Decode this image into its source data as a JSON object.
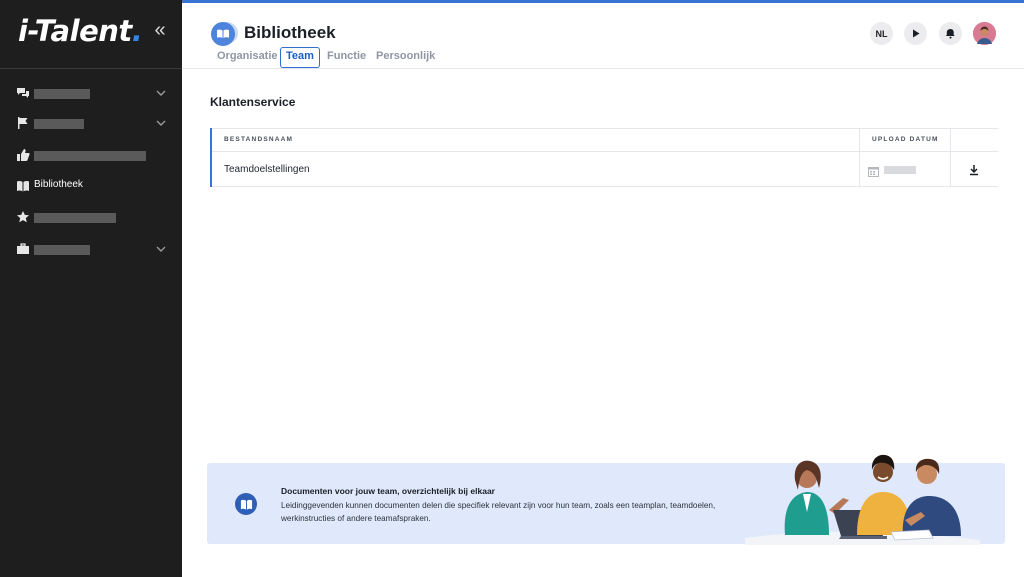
{
  "app": {
    "logo_main": "i-Talent",
    "logo_dot": "."
  },
  "colors": {
    "accent": "#3a73d6",
    "sidebar_bg": "#1e1e1e",
    "banner_bg": "#dfe9fb",
    "tab_active": "#1b5fc2"
  },
  "sidebar": {
    "collapse_icon": "double-chevron-left-icon",
    "items": [
      {
        "icon": "chat-icon",
        "label": "",
        "has_chevron": true
      },
      {
        "icon": "flag-icon",
        "label": "",
        "has_chevron": true
      },
      {
        "icon": "thumbs-up-icon",
        "label": "",
        "has_chevron": false
      },
      {
        "icon": "book-icon",
        "label": "Bibliotheek",
        "has_chevron": false
      },
      {
        "icon": "star-icon",
        "label": "",
        "has_chevron": false
      },
      {
        "icon": "briefcase-icon",
        "label": "",
        "has_chevron": true
      }
    ]
  },
  "header": {
    "title": "Bibliotheek",
    "tabs": [
      {
        "label": "Organisatie",
        "active": false
      },
      {
        "label": "Team",
        "active": true
      },
      {
        "label": "Functie",
        "active": false
      },
      {
        "label": "Persoonlijk",
        "active": false
      }
    ],
    "language": "NL",
    "icons": [
      "play-icon",
      "bell-icon",
      "avatar"
    ]
  },
  "main": {
    "section_title": "Klantenservice",
    "table": {
      "columns": [
        "BESTANDSNAAM",
        "UPLOAD DATUM",
        ""
      ],
      "rows": [
        {
          "name": "Teamdoelstellingen",
          "date": "",
          "action_icon": "download-icon"
        }
      ]
    }
  },
  "banner": {
    "icon": "book-icon",
    "title": "Documenten voor jouw team, overzichtelijk bij elkaar",
    "text": "Leidinggevenden kunnen documenten delen die specifiek relevant zijn voor hun team, zoals een teamplan, teamdoelen, werkinstructies of andere teamafspraken."
  }
}
